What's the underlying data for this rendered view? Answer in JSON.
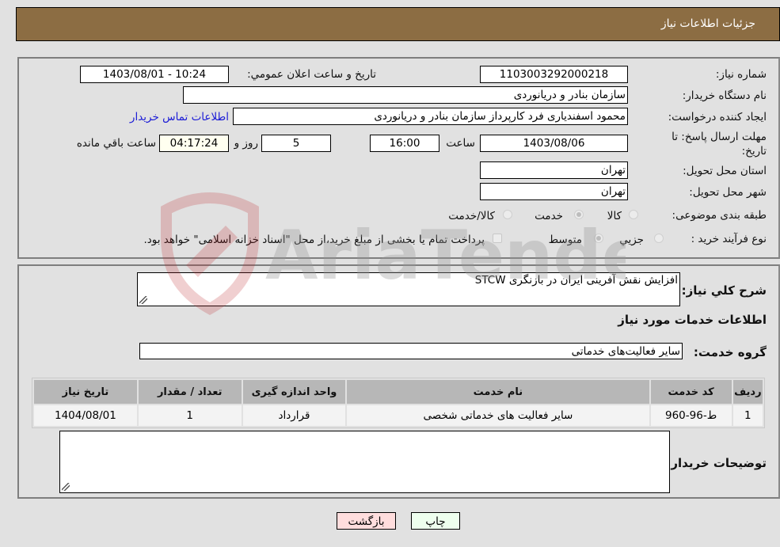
{
  "header": {
    "title": "جزئیات اطلاعات نیاز"
  },
  "details": {
    "need_number_label": "شماره نیاز:",
    "need_number": "1103003292000218",
    "announce_label": "تاریخ و ساعت اعلان عمومي:",
    "announce_value": "1403/08/01 - 10:24",
    "buyer_org_label": "نام دستگاه خریدار:",
    "buyer_org": "سازمان بنادر و دریانوردی",
    "creator_label": "ایجاد کننده درخواست:",
    "creator": "محمود اسفندیاری فرد کارپرداز سازمان بنادر و دریانوردی",
    "contact_link": "اطلاعات تماس خریدار",
    "deadline_label": "مهلت ارسال پاسخ: تا تاریخ:",
    "deadline_date": "1403/08/06",
    "time_label": "ساعت",
    "deadline_time": "16:00",
    "days_value": "5",
    "days_label": "روز و",
    "remaining_time": "04:17:24",
    "remaining_label": "ساعت باقي مانده",
    "province_label": "استان محل تحویل:",
    "province": "تهران",
    "city_label": "شهر محل تحویل:",
    "city": "تهران",
    "category_label": "طبقه بندی موضوعی:",
    "category_options": [
      "کالا",
      "خدمت",
      "کالا/خدمت"
    ],
    "category_selected": "خدمت",
    "process_label": "نوع فرآیند خرید :",
    "process_options": [
      "جزیي",
      "متوسط"
    ],
    "process_selected": "متوسط",
    "treasury_note": "پرداخت تمام یا بخشی از مبلغ خرید،از محل \"اسناد خزانه اسلامی\" خواهد بود."
  },
  "summary": {
    "description_label": "شرح كلي نياز:",
    "description": "افزایش نقش آفرینی ایران در بازنگری STCW",
    "services_heading": "اطلاعات خدمات مورد نياز",
    "service_group_label": "گروه خدمت:",
    "service_group": "سایر فعالیت‌های خدماتی"
  },
  "table": {
    "headers": [
      "رديف",
      "کد خدمت",
      "نام خدمت",
      "واحد اندازه گیری",
      "تعداد / مقدار",
      "تاریخ نیاز"
    ],
    "rows": [
      [
        "1",
        "ط-96-960",
        "سایر فعالیت های خدماتی شخصی",
        "قرارداد",
        "1",
        "1404/08/01"
      ]
    ]
  },
  "buyer_notes": {
    "label": "توضیحات خریدار:",
    "value": ""
  },
  "buttons": {
    "print": "چاپ",
    "back": "بازگشت"
  },
  "watermark": {
    "text": "AriaTender.neT"
  },
  "colors": {
    "header": "#8c6d43",
    "print_bg": "#eeffee",
    "back_bg": "#ffdddd",
    "link": "#1a1ad6"
  }
}
